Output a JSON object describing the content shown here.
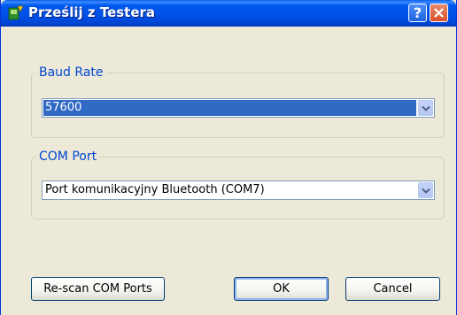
{
  "window": {
    "title": "Prześlij z Testera",
    "help_glyph": "?"
  },
  "baud_group": {
    "legend": "Baud Rate",
    "selected_value": "57600"
  },
  "com_group": {
    "legend": "COM Port",
    "selected_value": "Port komunikacyjny Bluetooth (COM7)"
  },
  "buttons": {
    "rescan_label": "Re-scan COM Ports",
    "ok_label": "OK",
    "cancel_label": "Cancel"
  },
  "colors": {
    "title_bar": "#0054e3",
    "selection": "#316ac5",
    "legend_text": "#0046d5",
    "dialog_bg": "#ece9d8"
  },
  "icons": [
    "app-icon",
    "help-icon",
    "close-icon",
    "chevron-down-icon"
  ]
}
